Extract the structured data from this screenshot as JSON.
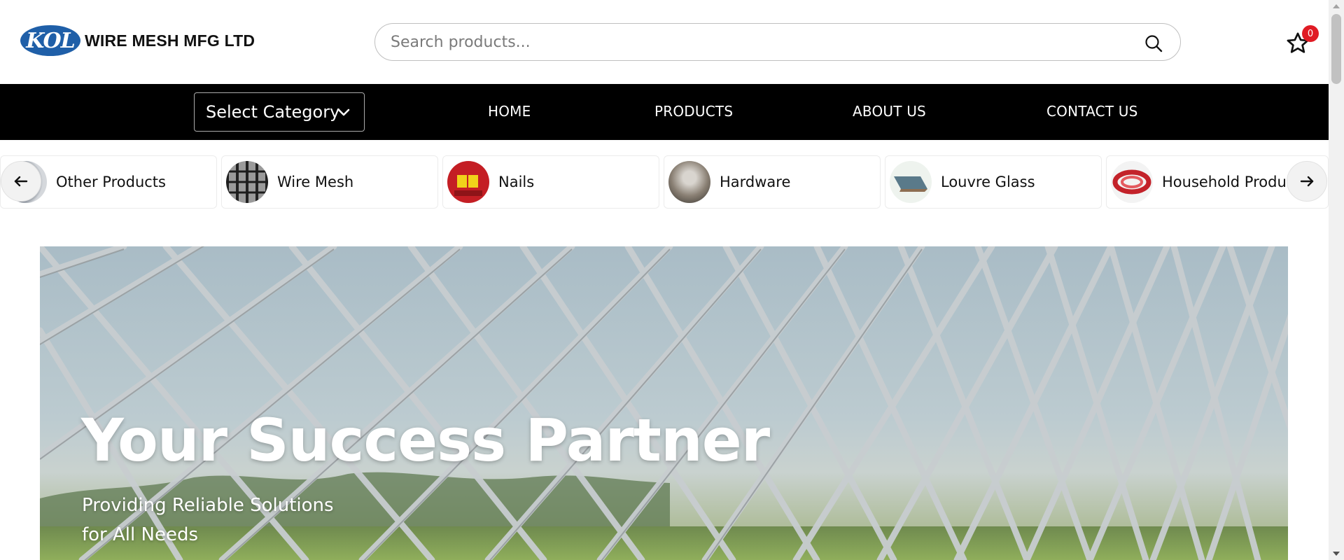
{
  "brand": {
    "logo_mark": "KOL",
    "name": "WIRE MESH MFG LTD",
    "logo_color": "#1f5fa8"
  },
  "search": {
    "placeholder": "Search products...",
    "value": "",
    "icon": "search-icon"
  },
  "favorites": {
    "icon": "star-icon",
    "count": "0",
    "badge_color": "#e01b24"
  },
  "navbar": {
    "category_select": "Select Category",
    "links": [
      "HOME",
      "PRODUCTS",
      "ABOUT US",
      "CONTACT US"
    ]
  },
  "categories": {
    "prev_icon": "arrow-left-icon",
    "next_icon": "arrow-right-icon",
    "items": [
      {
        "label": "Other Products"
      },
      {
        "label": "Wire Mesh"
      },
      {
        "label": "Nails"
      },
      {
        "label": "Hardware"
      },
      {
        "label": "Louvre Glass"
      },
      {
        "label": "Household Products"
      }
    ]
  },
  "hero": {
    "title": "Your Success Partner",
    "subtitle_line1": "Providing Reliable Solutions",
    "subtitle_line2": "for All Needs"
  }
}
